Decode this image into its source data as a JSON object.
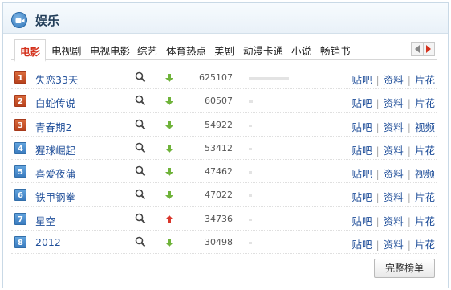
{
  "header": {
    "title": "娱乐",
    "icon": "video-camera-icon"
  },
  "tabs": [
    {
      "label": "电影",
      "active": true
    },
    {
      "label": "电视剧",
      "active": false
    },
    {
      "label": "电视电影",
      "active": false
    },
    {
      "label": "综艺",
      "active": false
    },
    {
      "label": "体育热点",
      "active": false
    },
    {
      "label": "美剧",
      "active": false
    },
    {
      "label": "动漫卡通",
      "active": false
    },
    {
      "label": "小说",
      "active": false
    },
    {
      "label": "畅销书",
      "active": false
    }
  ],
  "rows": [
    {
      "rank": "1",
      "name": "失恋33天",
      "trend": "down",
      "count": "625107",
      "bar_fraction": 1.0,
      "links": [
        "贴吧",
        "资料",
        "片花"
      ]
    },
    {
      "rank": "2",
      "name": "白蛇传说",
      "trend": "down",
      "count": "60507",
      "bar_fraction": 0.097,
      "links": [
        "贴吧",
        "资料",
        "片花"
      ]
    },
    {
      "rank": "3",
      "name": "青春期2",
      "trend": "down",
      "count": "54922",
      "bar_fraction": 0.088,
      "links": [
        "贴吧",
        "资料",
        "视频"
      ]
    },
    {
      "rank": "4",
      "name": "猩球崛起",
      "trend": "down",
      "count": "53412",
      "bar_fraction": 0.085,
      "links": [
        "贴吧",
        "资料",
        "片花"
      ]
    },
    {
      "rank": "5",
      "name": "喜爱夜蒲",
      "trend": "down",
      "count": "47462",
      "bar_fraction": 0.076,
      "links": [
        "贴吧",
        "资料",
        "视频"
      ]
    },
    {
      "rank": "6",
      "name": "铁甲钢拳",
      "trend": "down",
      "count": "47022",
      "bar_fraction": 0.075,
      "links": [
        "贴吧",
        "资料",
        "片花"
      ]
    },
    {
      "rank": "7",
      "name": "星空",
      "trend": "up",
      "count": "34736",
      "bar_fraction": 0.056,
      "links": [
        "贴吧",
        "资料",
        "片花"
      ]
    },
    {
      "rank": "8",
      "name": "2012",
      "trend": "down",
      "count": "30498",
      "bar_fraction": 0.049,
      "links": [
        "贴吧",
        "资料",
        "片花"
      ]
    }
  ],
  "footer": {
    "full_list_label": "完整榜单"
  },
  "colors": {
    "trend_down": "#6fb33a",
    "trend_up": "#d9362b",
    "rank_top": "#c24b22",
    "rank_other": "#3f80c4",
    "link": "#1f4e99",
    "active_tab": "#d4311c"
  }
}
